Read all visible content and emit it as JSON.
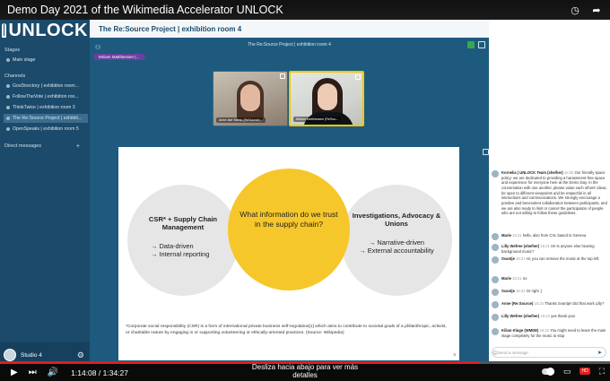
{
  "video": {
    "title": "Demo Day 2021 of the Wikimedia Accelerator UNLOCK",
    "time_current": "1:14:08",
    "time_total": "1:34:27",
    "progress_fraction": 0.785,
    "hint": "Desliza hacia abajo para ver más detalles"
  },
  "app": {
    "logo": "UNLOCK",
    "room_title": "The Re:Source Project | exhibition room 4",
    "stage_title": "The Re:Source Project | exhibition room 4",
    "me_chip": "Miriam Matthiessen (...",
    "sidebar": {
      "stages_header": "Stages",
      "stages": [
        "Main stage"
      ],
      "channels_header": "Channels",
      "channels": [
        "GovDirectory | exhibition room...",
        "FollowTheVote | exhibition roo...",
        "ThinkTwice | exhibition room 3",
        "The Re:Source Project | exhibiti...",
        "OpenSpeaks | exhibition room 5"
      ],
      "dm_header": "Direct messages",
      "studio_name": "Studio 4"
    },
    "cams": [
      {
        "label": "Anne-Iser Maniu (ReSource)..."
      },
      {
        "label": "Miriam Matthiessen (ReSou..."
      }
    ]
  },
  "slide": {
    "left_title": "CSR* + Supply Chain Management",
    "left_points": "→ Data-driven\n→ Internal reporting",
    "center": "What information do we trust in the supply chain?",
    "right_title": "Investigations, Advocacy & Unions",
    "right_points": "→ Narrative-driven\n→ External accountability",
    "footnote": "*Corporate social responsibility (CSR) is a form of international private business self-regulation[1] which aims to contribute to societal goals of a philanthropic, activist, or charitable nature by engaging in or supporting volunteering or ethically-oriented practices. (Source: Wikipedia)",
    "page_number": "6"
  },
  "chat": {
    "messages": [
      {
        "name": "Kornelia | UNLOCK Team (she/her)",
        "time": "16:35",
        "text": "Our friendly space policy: we are dedicated to providing a harassment-free space and experience for everyone here at the Demo Day. In the conversation with one another, please value each others' ideas, be open to different viewpoints and be respectful in all interactions and communications. We strongly encourage a positive and benevolent collaboration between participants, and we are also ready to limit or cancel the participation of people who are not willing to follow these guidelines."
      },
      {
        "name": "Marie",
        "time": "16:21",
        "text": "hello, also from CVL based in Geneva"
      },
      {
        "name": "Lilly Wefree (she/her)",
        "time": "16:21",
        "text": "Hi! Is anyone else hearing background music?"
      },
      {
        "name": "Svantje",
        "time": "16:21",
        "text": "Hi, you can remove the music at the top left."
      },
      {
        "name": "Marie",
        "time": "16:21",
        "text": "no"
      },
      {
        "name": "Svantje",
        "time": "16:22",
        "text": "Or right :)"
      },
      {
        "name": "Anne (Re:Source)",
        "time": "16:22",
        "text": "Thanks Svantje! Did that work Lilly?"
      },
      {
        "name": "Lilly Wefree (she/her)",
        "time": "16:22",
        "text": "yes thank you!"
      },
      {
        "name": "Kilian Kluge (WMDE)",
        "time": "16:22",
        "text": "You might need to leave the main stage completely for the music to stop"
      }
    ],
    "input_placeholder": "Send a message"
  },
  "colors": {
    "accent": "#f6c72a",
    "sidebar": "#1b4a6b",
    "stage": "#1e5a7e",
    "yt_red": "#e21d1d"
  }
}
